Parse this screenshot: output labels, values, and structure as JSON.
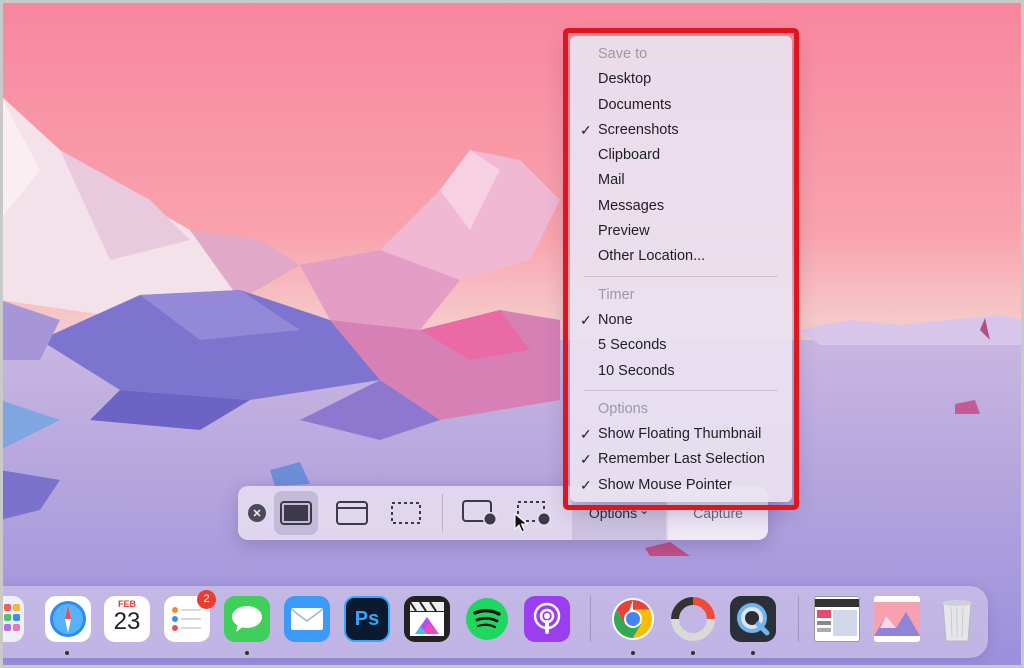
{
  "toolbar": {
    "options_label": "Options",
    "options_chevron": "⌄",
    "capture_label": "Capture",
    "buttons": [
      "close-icon",
      "capture-entire-screen-icon",
      "capture-window-icon",
      "capture-selection-icon",
      "record-entire-screen-icon",
      "record-selection-icon"
    ]
  },
  "menu": {
    "save_to_header": "Save to",
    "save_to": [
      {
        "label": "Desktop",
        "checked": false
      },
      {
        "label": "Documents",
        "checked": false
      },
      {
        "label": "Screenshots",
        "checked": true
      },
      {
        "label": "Clipboard",
        "checked": false
      },
      {
        "label": "Mail",
        "checked": false
      },
      {
        "label": "Messages",
        "checked": false
      },
      {
        "label": "Preview",
        "checked": false
      },
      {
        "label": "Other Location...",
        "checked": false
      }
    ],
    "timer_header": "Timer",
    "timer": [
      {
        "label": "None",
        "checked": true
      },
      {
        "label": "5 Seconds",
        "checked": false
      },
      {
        "label": "10 Seconds",
        "checked": false
      }
    ],
    "options_header": "Options",
    "options": [
      {
        "label": "Show Floating Thumbnail",
        "checked": true
      },
      {
        "label": "Remember Last Selection",
        "checked": true
      },
      {
        "label": "Show Mouse Pointer",
        "checked": true
      }
    ],
    "check_glyph": "✓",
    "highlight_color": "#e0161e"
  },
  "dock": {
    "calendar_month": "FEB",
    "calendar_day": "23",
    "reminders_badge": "2",
    "photoshop_label": "Ps",
    "apps": [
      "launchpad-icon",
      "safari-icon",
      "calendar-icon",
      "reminders-icon",
      "messages-icon",
      "mail-icon",
      "photoshop-icon",
      "final-cut-pro-icon",
      "spotify-icon",
      "podcasts-icon",
      "chrome-icon",
      "creative-cloud-icon",
      "quicktime-icon",
      "screenshot-thumbnail-icon",
      "wallpaper-thumbnail-icon",
      "trash-icon"
    ]
  }
}
